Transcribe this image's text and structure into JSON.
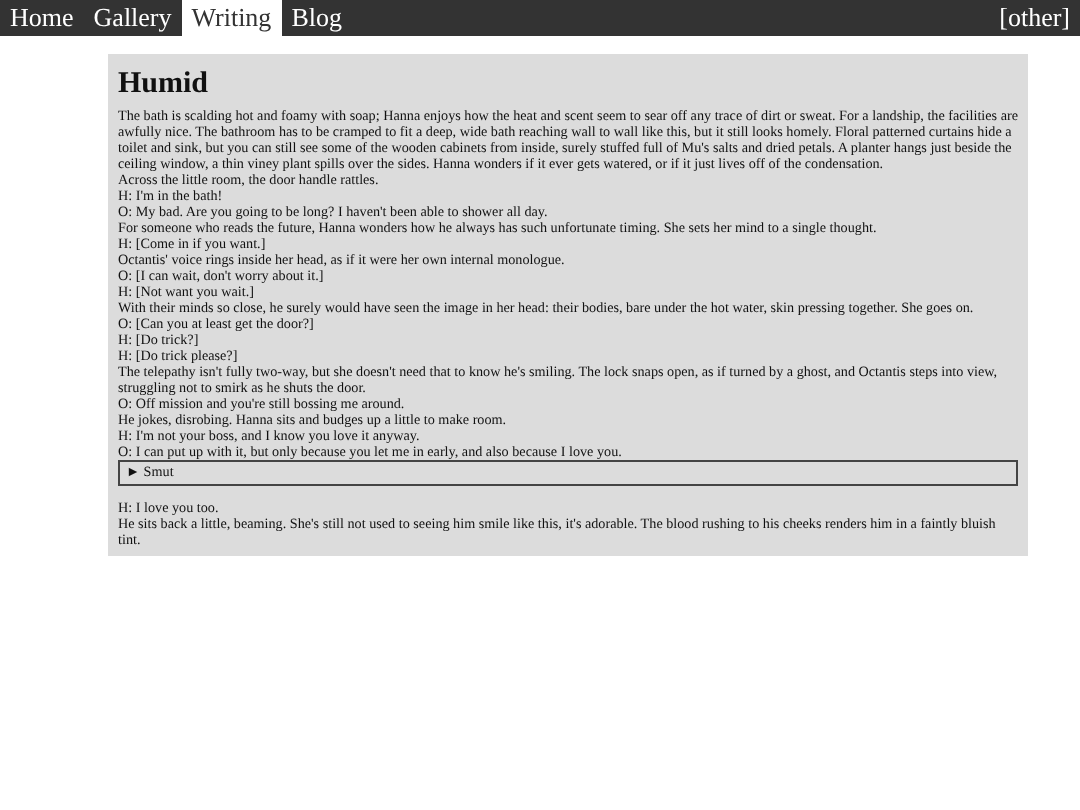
{
  "nav": {
    "items": [
      {
        "label": "Home",
        "selected": false
      },
      {
        "label": "Gallery",
        "selected": false
      },
      {
        "label": "Writing",
        "selected": true
      },
      {
        "label": "Blog",
        "selected": false
      }
    ],
    "other": "[other]"
  },
  "story": {
    "title": "Humid",
    "lines": [
      "The bath is scalding hot and foamy with soap; Hanna enjoys how the heat and scent seem to sear off any trace of dirt or sweat. For a landship, the facilities are awfully nice. The bathroom has to be cramped to fit a deep, wide bath reaching wall to wall like this, but it still looks homely. Floral patterned curtains hide a toilet and sink, but you can still see some of the wooden cabinets from inside, surely stuffed full of Mu's salts and dried petals. A planter hangs just beside the ceiling window, a thin viney plant spills over the sides. Hanna wonders if it ever gets watered, or if it just lives off of the condensation.",
      "Across the little room, the door handle rattles.",
      "H: I'm in the bath!",
      "O: My bad. Are you going to be long? I haven't been able to shower all day.",
      "For someone who reads the future, Hanna wonders how he always has such unfortunate timing. She sets her mind to a single thought.",
      "H: [Come in if you want.]",
      "Octantis' voice rings inside her head, as if it were her own internal monologue.",
      "O: [I can wait, don't worry about it.]",
      "H: [Not want you wait.]",
      "With their minds so close, he surely would have seen the image in her head: their bodies, bare under the hot water, skin pressing together. She goes on.",
      "O: [Can you at least get the door?]",
      "H: [Do trick?]",
      "H: [Do trick please?]",
      "The telepathy isn't fully two-way, but she doesn't need that to know he's smiling. The lock snaps open, as if turned by a ghost, and Octantis steps into view, struggling not to smirk as he shuts the door.",
      "O: Off mission and you're still bossing me around.",
      "He jokes, disrobing. Hanna sits and budges up a little to make room.",
      "H: I'm not your boss, and I know you love it anyway.",
      "O: I can put up with it, but only because you let me in early, and also because I love you."
    ],
    "details": {
      "arrow": "►",
      "summary": "Smut",
      "expanded": false
    },
    "after": [
      "H: I love you too.",
      "He sits back a little, beaming. She's still not used to seeing him smile like this, it's adorable. The blood rushing to his cheeks renders him in a faintly bluish tint."
    ]
  }
}
